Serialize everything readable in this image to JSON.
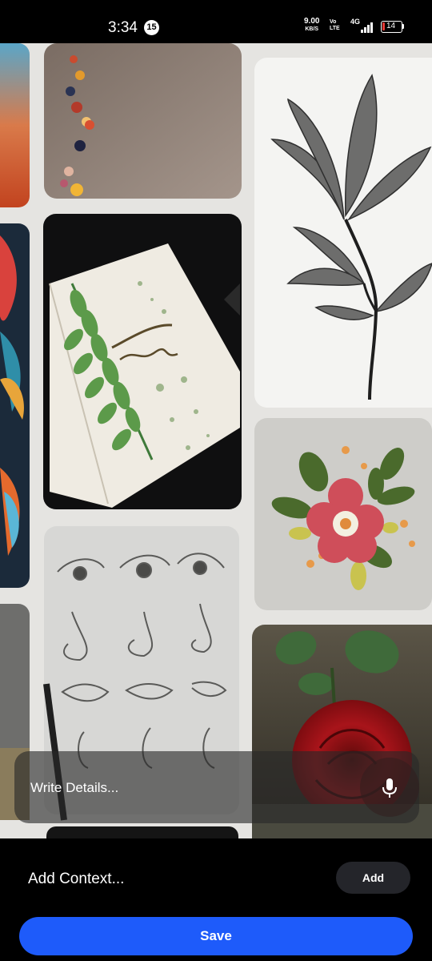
{
  "status_bar": {
    "time": "3:34",
    "notification_count": "15",
    "net_speed": "9.00",
    "net_speed_unit": "KB/S",
    "volte_top": "Vo",
    "volte_bottom": "LTE",
    "network": "4G",
    "battery_level": "14",
    "battery_color": "#e53935"
  },
  "photo": {
    "description_icon_names": [
      "pinboard-photo"
    ]
  },
  "details": {
    "placeholder": "Write Details...",
    "mic_icon": "microphone-icon"
  },
  "context": {
    "label": "Add Context...",
    "add_label": "Add"
  },
  "actions": {
    "save_label": "Save",
    "save_color": "#1e5bfa"
  }
}
